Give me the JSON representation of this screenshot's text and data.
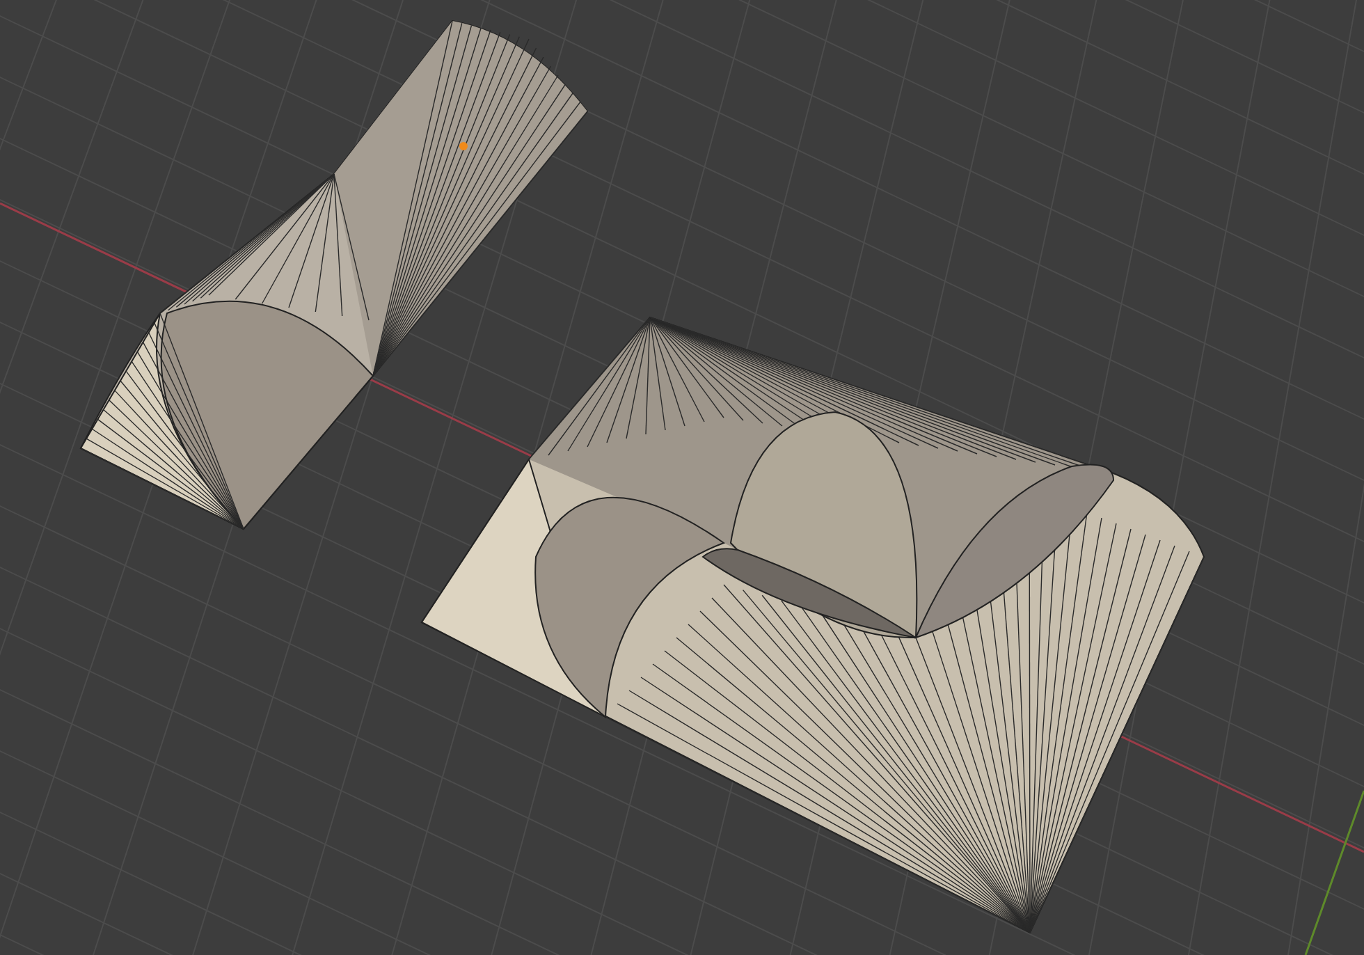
{
  "viewport": {
    "objects": [
      {
        "kind": "mesh"
      },
      {
        "kind": "mesh"
      }
    ]
  }
}
